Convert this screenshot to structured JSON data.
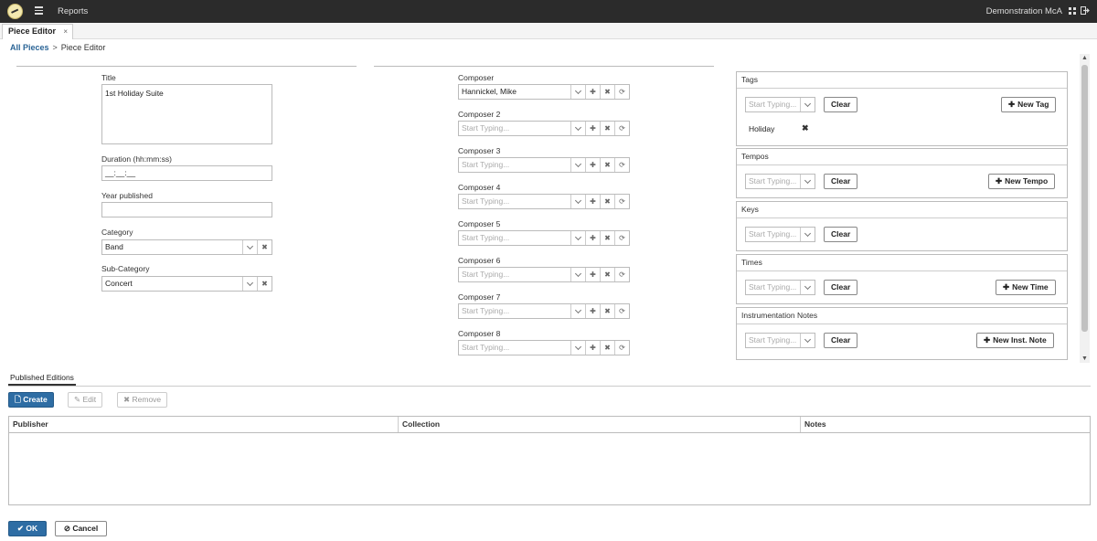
{
  "topbar": {
    "nav_label": "Reports",
    "user_name": "Demonstration McA"
  },
  "tab": {
    "label": "Piece Editor",
    "close": "×"
  },
  "breadcrumb": {
    "root": "All Pieces",
    "sep": ">",
    "current": "Piece Editor"
  },
  "form": {
    "title_label": "Title",
    "title_value": "1st Holiday Suite",
    "duration_label": "Duration (hh:mm:ss)",
    "duration_value": "__:__:__",
    "year_label": "Year published",
    "year_value": "",
    "category_label": "Category",
    "category_value": "Band",
    "subcategory_label": "Sub-Category",
    "subcategory_value": "Concert"
  },
  "composers": [
    {
      "label": "Composer",
      "value": "Hannickel, Mike"
    },
    {
      "label": "Composer 2",
      "value": "Start Typing..."
    },
    {
      "label": "Composer 3",
      "value": "Start Typing..."
    },
    {
      "label": "Composer 4",
      "value": "Start Typing..."
    },
    {
      "label": "Composer 5",
      "value": "Start Typing..."
    },
    {
      "label": "Composer 6",
      "value": "Start Typing..."
    },
    {
      "label": "Composer 7",
      "value": "Start Typing..."
    },
    {
      "label": "Composer 8",
      "value": "Start Typing..."
    }
  ],
  "panels": {
    "tags": {
      "title": "Tags",
      "placeholder": "Start Typing...",
      "clear": "Clear",
      "new_label": "New Tag",
      "items": [
        "Holiday"
      ]
    },
    "tempos": {
      "title": "Tempos",
      "placeholder": "Start Typing...",
      "clear": "Clear",
      "new_label": "New Tempo"
    },
    "keys": {
      "title": "Keys",
      "placeholder": "Start Typing...",
      "clear": "Clear"
    },
    "times": {
      "title": "Times",
      "placeholder": "Start Typing...",
      "clear": "Clear",
      "new_label": "New Time"
    },
    "instrumentation": {
      "title": "Instrumentation Notes",
      "placeholder": "Start Typing...",
      "clear": "Clear",
      "new_label": "New Inst. Note"
    }
  },
  "editions": {
    "tab_label": "Published Editions",
    "create": "Create",
    "edit": "Edit",
    "remove": "Remove",
    "columns": [
      "Publisher",
      "Collection",
      "Notes"
    ]
  },
  "footer": {
    "ok": "OK",
    "cancel": "Cancel"
  }
}
